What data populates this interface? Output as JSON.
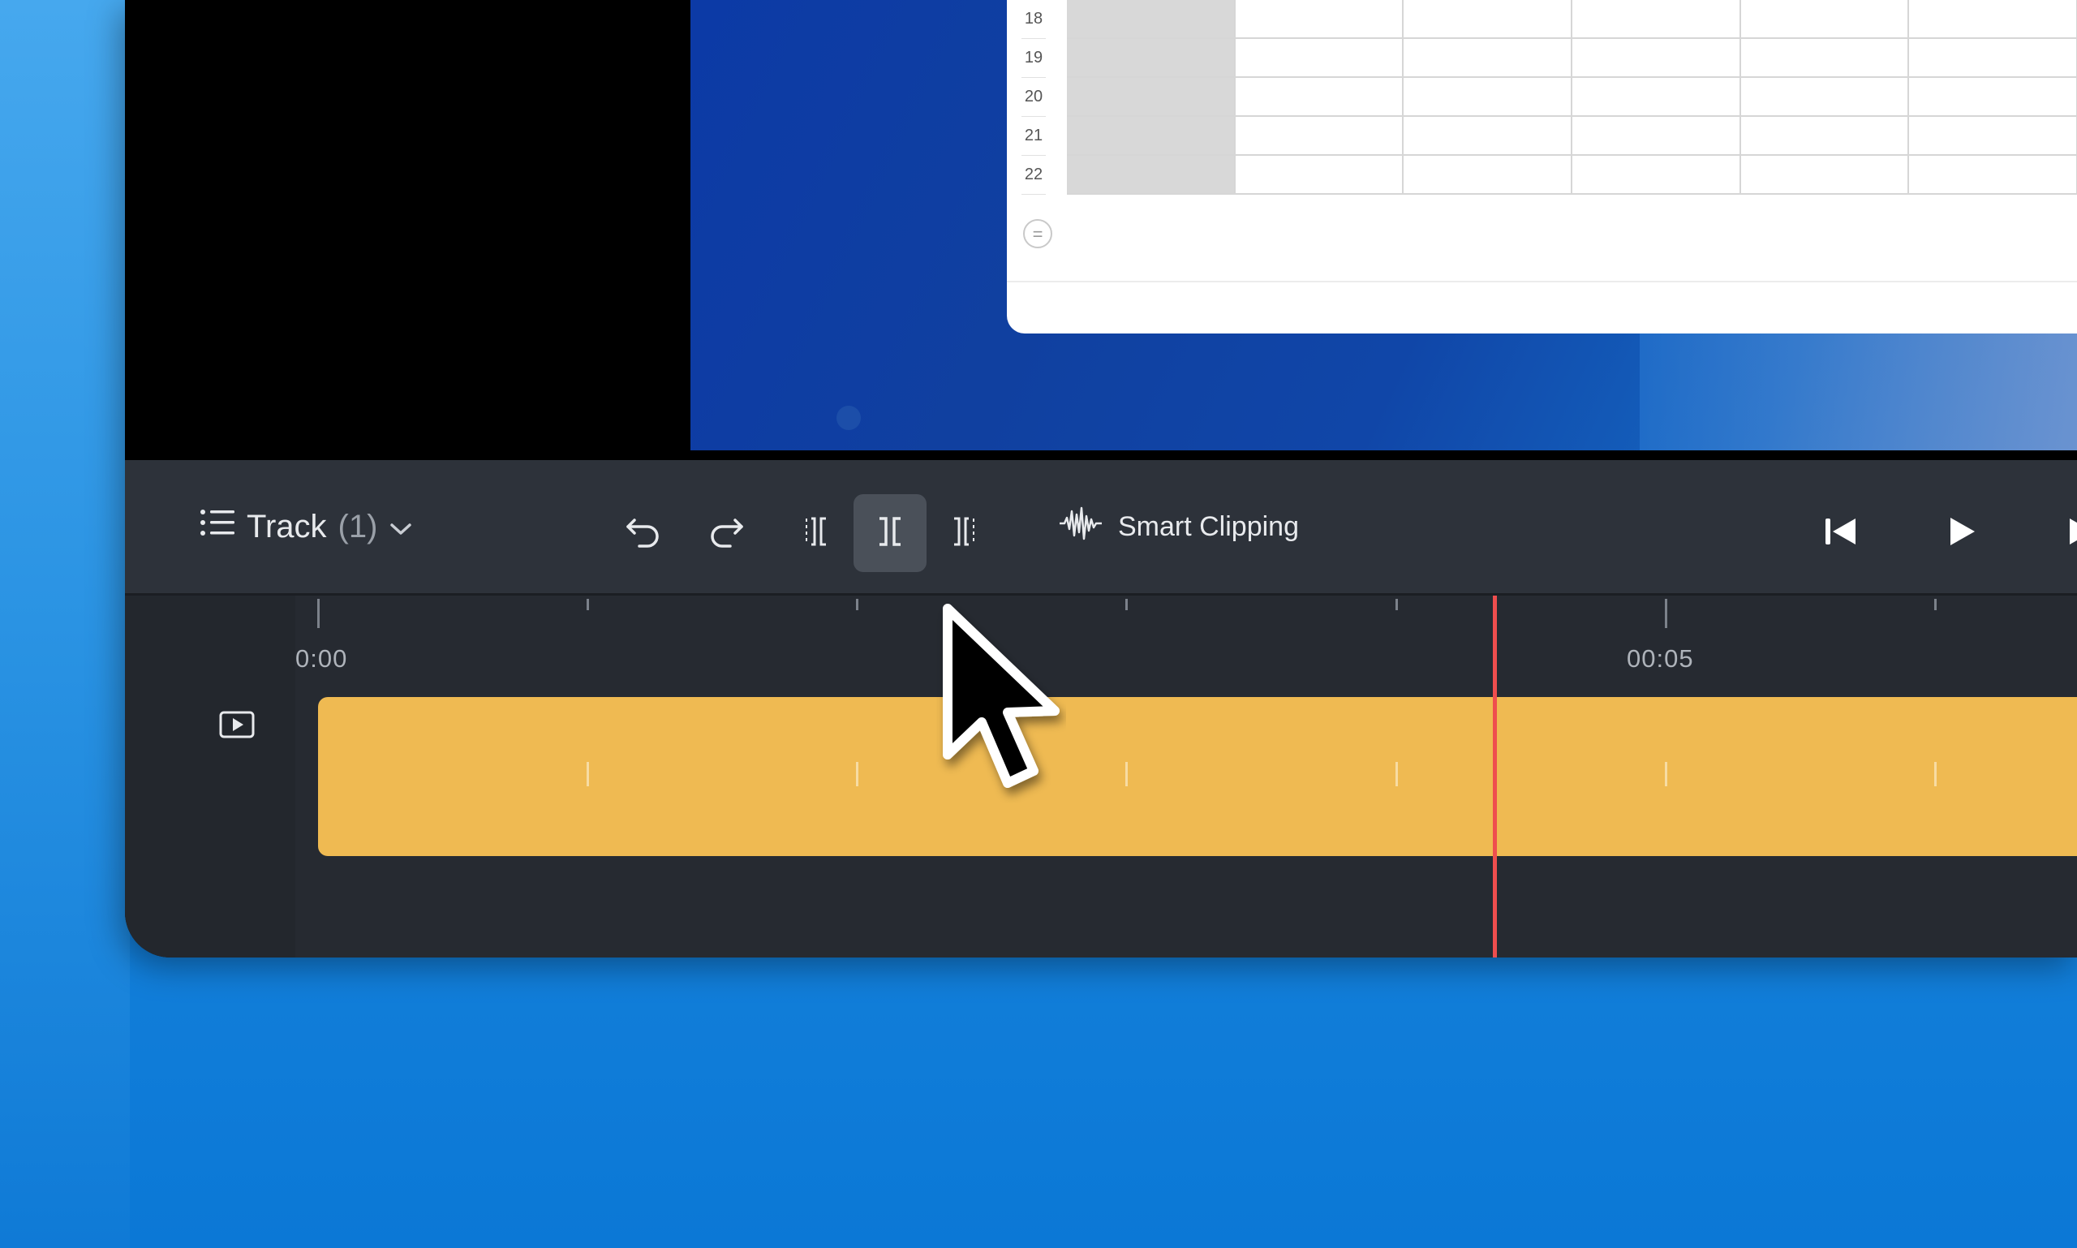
{
  "sheet": {
    "row_numbers": [
      "18",
      "19",
      "20",
      "21",
      "22"
    ],
    "add_row_symbol": "="
  },
  "toolbar": {
    "track_label": "Track",
    "track_count": "(1)",
    "smart_clipping_label": "Smart Clipping"
  },
  "timeline": {
    "start_label": "0:00",
    "mark_label": "00:05"
  },
  "icons": {
    "track_menu": "list-icon",
    "dropdown": "chevron-down-icon",
    "undo": "undo-icon",
    "redo": "redo-icon",
    "trim_start": "trim-start-icon",
    "split": "split-icon",
    "trim_end": "trim-end-icon",
    "waveform": "waveform-icon",
    "skip_back": "skip-back-icon",
    "play": "play-icon",
    "skip_forward": "skip-forward-icon",
    "video_track": "video-track-icon",
    "cursor": "mouse-pointer-icon"
  },
  "colors": {
    "clip": "#efba52",
    "playhead": "#ef4e4e",
    "toolbar": "#2d323a",
    "timeline": "#262a31"
  }
}
